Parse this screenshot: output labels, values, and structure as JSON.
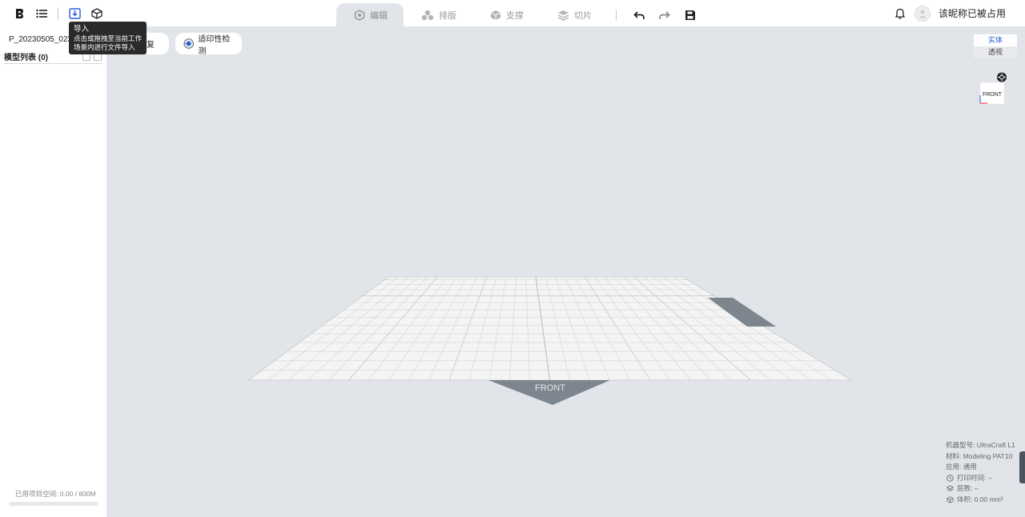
{
  "topbar": {
    "tabs": [
      {
        "label": "编辑",
        "icon": "edit-hexagon-icon"
      },
      {
        "label": "排版",
        "icon": "layout-spheres-icon"
      },
      {
        "label": "支撑",
        "icon": "support-cube-icon"
      },
      {
        "label": "切片",
        "icon": "slice-layers-icon"
      }
    ],
    "username": "该昵称已被占用"
  },
  "tooltip": {
    "title": "导入",
    "line1": "点击或拖拽至当前工作",
    "line2": "场景内进行文件导入"
  },
  "sidebar": {
    "project_name": "P_20230505_0230",
    "model_list_title": "模型列表 (0)",
    "storage_text": "已用项目空间: 0.00 / 800M",
    "storage_used_fraction": 0
  },
  "viewport": {
    "repair_label": "修复",
    "printability_label": "适印性检测",
    "view_solid": "实体",
    "view_perspective": "透视",
    "cube_face": "FRONT",
    "plate_front": "FRONT",
    "info": {
      "machine": "机器型号:  UltraCraft L1",
      "material": "材料:  Modeling PAT10",
      "application": "应用:  通用",
      "print_time": "打印时间: --",
      "layers": "层数: --",
      "volume": "体积: 0.00 mm³"
    }
  },
  "colors": {
    "viewport_bg": "#e1e5ea",
    "accent": "#2b5bd7",
    "plate_grid": "#f4f4f4",
    "plate_tag": "#7d868f"
  }
}
